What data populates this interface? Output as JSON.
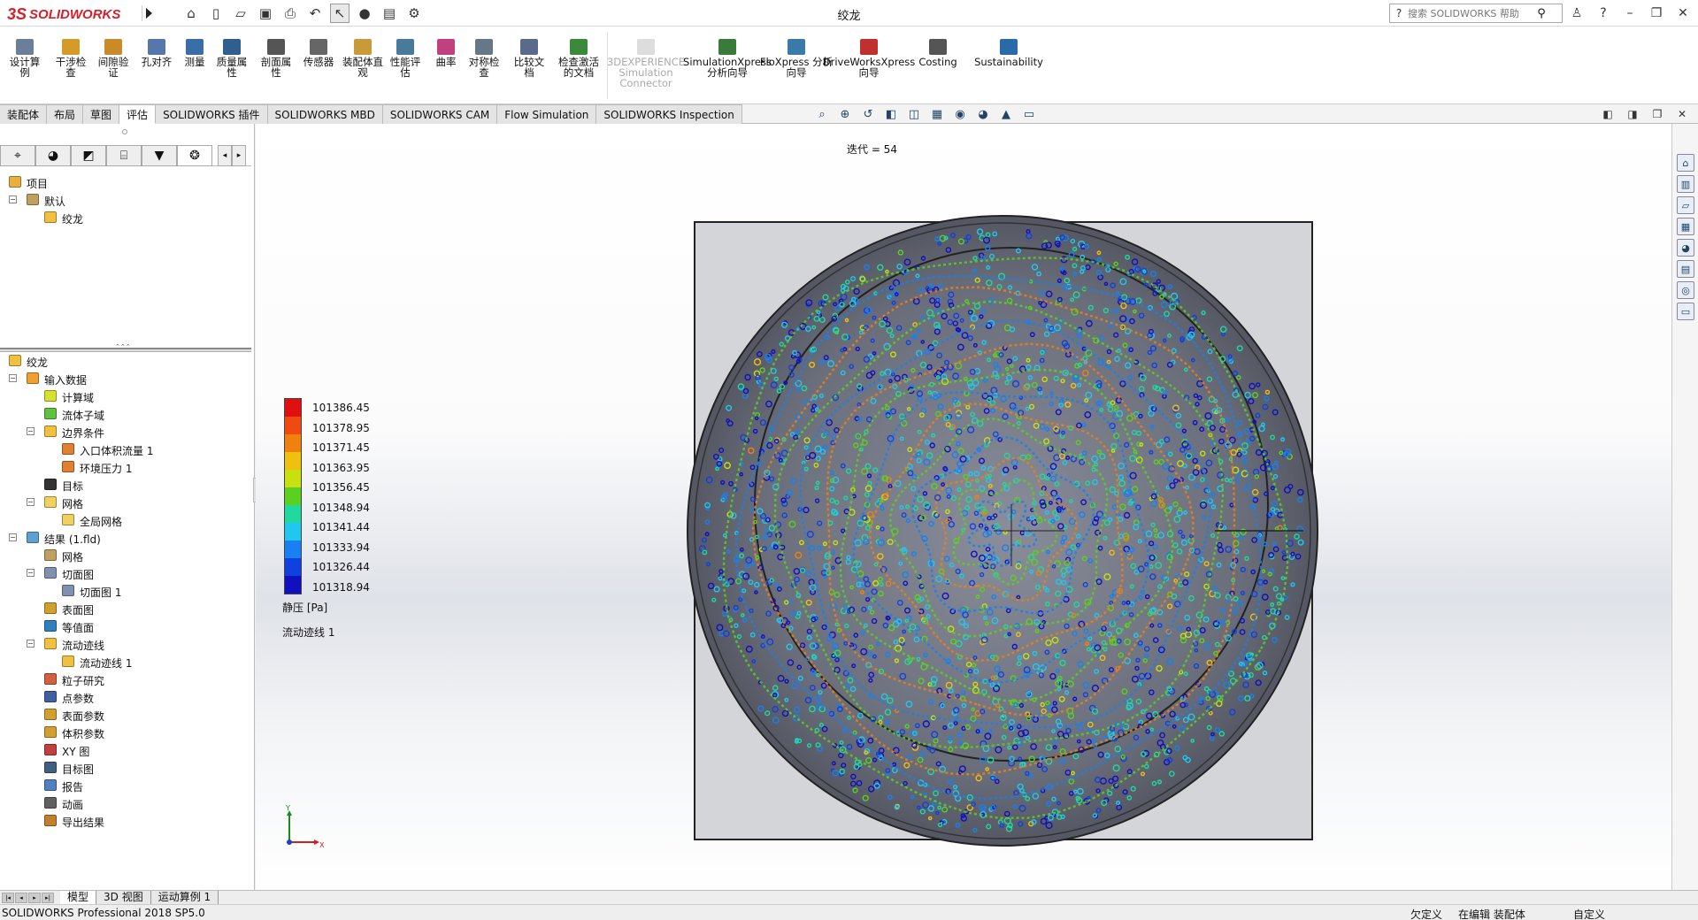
{
  "titlebar": {
    "brand_mark": "3S",
    "brand_name": "SOLIDWORKS",
    "document_title": "绞龙",
    "search_placeholder": "搜索 SOLIDWORKS 帮助",
    "quick_icons": [
      "home-icon",
      "new-document-icon",
      "open-icon",
      "save-icon",
      "print-icon",
      "undo-icon",
      "select-pointer-icon",
      "traffic-light-icon",
      "file-properties-icon",
      "options-gear-icon"
    ],
    "window_icons": [
      "user-icon",
      "help-icon",
      "minimize-icon",
      "restore-icon",
      "close-icon"
    ]
  },
  "ribbon": {
    "buttons": [
      {
        "label": "设计算例",
        "color": "#6a7f99"
      },
      {
        "label": "干涉检查",
        "color": "#d49a2a"
      },
      {
        "label": "间隙验证",
        "color": "#c98a2a"
      },
      {
        "label": "孔对齐",
        "color": "#5577aa"
      },
      {
        "label": "测量",
        "color": "#3a6ea8"
      },
      {
        "label": "质量属性",
        "color": "#2f5f8f"
      },
      {
        "label": "剖面属性",
        "color": "#555"
      },
      {
        "label": "传感器",
        "color": "#666"
      },
      {
        "label": "装配体直观",
        "color": "#c89b3a"
      },
      {
        "label": "性能评估",
        "color": "#4a7a9a"
      },
      {
        "label": "曲率",
        "color": "#c04080"
      },
      {
        "label": "对称检查",
        "color": "#667788"
      },
      {
        "label": "比较文档",
        "color": "#5a6a8a"
      },
      {
        "label": "检查激活的文档",
        "color": "#3a8a3a"
      },
      {
        "label": "3DEXPERIENCE Simulation Connector",
        "color": "#bbb",
        "disabled": true
      },
      {
        "label": "SimulationXpress 分析向导",
        "color": "#3a7a3a"
      },
      {
        "label": "FloXpress 分析向导",
        "color": "#3a7aa8"
      },
      {
        "label": "DriveWorksXpress 向导",
        "color": "#c03030"
      },
      {
        "label": "Costing",
        "color": "#555"
      },
      {
        "label": "Sustainability",
        "color": "#2a6aa8"
      }
    ]
  },
  "command_tabs": [
    "装配体",
    "布局",
    "草图",
    "评估",
    "SOLIDWORKS 插件",
    "SOLIDWORKS MBD",
    "SOLIDWORKS CAM",
    "Flow Simulation",
    "SOLIDWORKS Inspection"
  ],
  "active_command_tab": "评估",
  "view_tools": [
    "zoom-to-fit-icon",
    "zoom-area-icon",
    "previous-view-icon",
    "section-view-icon",
    "view-orientation-icon",
    "display-style-icon",
    "hide-show-icon",
    "edit-appearance-icon",
    "apply-scene-icon",
    "view-settings-icon"
  ],
  "config_tree": {
    "root": "项目",
    "default": "默认",
    "item": "绞龙"
  },
  "flow_tree": {
    "root": "绞龙",
    "input_data": "输入数据",
    "comp_domain": "计算域",
    "fluid_subdomain": "流体子域",
    "boundary_conditions": "边界条件",
    "inlet_volume_flow": "入口体积流量 1",
    "env_pressure": "环境压力 1",
    "goals": "目标",
    "mesh": "网格",
    "global_mesh": "全局网格",
    "results": "结果 (1.fld)",
    "results_mesh": "网格",
    "cut_plots": "切面图",
    "cut_plot_1": "切面图 1",
    "surface_plots": "表面图",
    "isosurfaces": "等值面",
    "flow_trajectories": "流动迹线",
    "flow_trajectories_1": "流动迹线 1",
    "particle_studies": "粒子研究",
    "point_params": "点参数",
    "surface_params": "表面参数",
    "volume_params": "体积参数",
    "xy_plots": "XY 图",
    "goal_plots": "目标图",
    "report": "报告",
    "animations": "动画",
    "export_results": "导出结果"
  },
  "graphics": {
    "iteration": "迭代 = 54",
    "legend_values": [
      "101386.45",
      "101378.95",
      "101371.45",
      "101363.95",
      "101356.45",
      "101348.94",
      "101341.44",
      "101333.94",
      "101326.44",
      "101318.94"
    ],
    "legend_colors": [
      "#e01010",
      "#f04a10",
      "#f08010",
      "#f0c010",
      "#c8e010",
      "#5cd020",
      "#20d8a0",
      "#20c8f0",
      "#1880f0",
      "#1040e0",
      "#1010c0"
    ],
    "legend_unit": "静压 [Pa]",
    "trajectory_label": "流动迹线 1",
    "triad_y": "Y",
    "triad_x": "X"
  },
  "bottom_tabs": [
    "模型",
    "3D 视图",
    "运动算例 1"
  ],
  "active_bottom_tab": "模型",
  "status": {
    "product": "SOLIDWORKS Professional 2018 SP5.0",
    "definition": "欠定义",
    "editing": "在编辑 装配体",
    "units": "自定义"
  }
}
